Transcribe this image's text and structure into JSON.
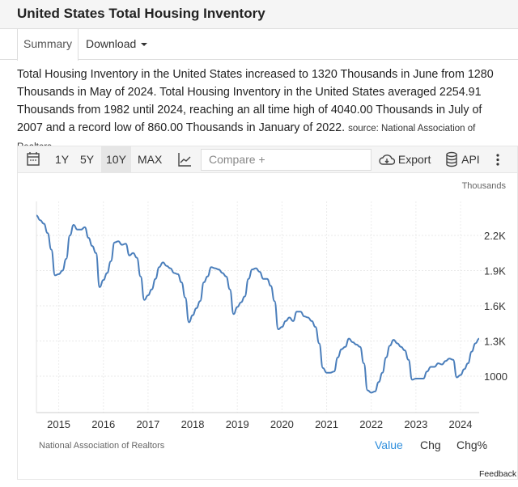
{
  "header": {
    "title": "United States Total Housing Inventory"
  },
  "tabs": {
    "summary": "Summary",
    "download": "Download"
  },
  "description": {
    "text": "Total Housing Inventory in the United States increased to 1320 Thousands in June from 1280 Thousands in May of 2024. Total Housing Inventory in the United States averaged 2254.91 Thousands from 1982 until 2024, reaching an all time high of 4040.00 Thousands in July of 2007 and a record low of 860.00 Thousands in January of 2022.",
    "source": "source: National Association of Realtors"
  },
  "toolbar": {
    "ranges": [
      "1Y",
      "5Y",
      "10Y",
      "MAX"
    ],
    "selected_range": "10Y",
    "compare_placeholder": "Compare +",
    "export": "Export",
    "api": "API"
  },
  "chart_footer": {
    "source": "National Association of Realtors",
    "views": [
      "Value",
      "Chg",
      "Chg%"
    ],
    "selected_view": "Value",
    "feedback": "Feedback"
  },
  "colors": {
    "line": "#4a7ebb",
    "active_view": "#2f8fdd"
  },
  "chart_data": {
    "type": "line",
    "unit_label": "Thousands",
    "x_tick_labels": [
      "2015",
      "2016",
      "2017",
      "2018",
      "2019",
      "2020",
      "2021",
      "2022",
      "2023",
      "2024"
    ],
    "y_ticks": [
      1000,
      1300,
      1600,
      1900,
      2200
    ],
    "y_tick_labels": [
      "1000",
      "1.3K",
      "1.6K",
      "1.9K",
      "2.2K"
    ],
    "ylim": [
      690,
      2490
    ],
    "xlim": [
      "2014-07",
      "2024-06"
    ],
    "grid": true,
    "start": "2014-07",
    "frequency": "monthly",
    "values": [
      2370,
      2330,
      2300,
      2220,
      2080,
      1860,
      1870,
      1900,
      2000,
      2200,
      2290,
      2250,
      2250,
      2270,
      2180,
      2110,
      2050,
      1760,
      1820,
      1880,
      1980,
      2140,
      2150,
      2120,
      2130,
      2030,
      2050,
      2010,
      1850,
      1650,
      1690,
      1740,
      1830,
      1930,
      1970,
      1940,
      1920,
      1880,
      1870,
      1800,
      1670,
      1460,
      1520,
      1580,
      1640,
      1800,
      1850,
      1930,
      1920,
      1910,
      1880,
      1850,
      1740,
      1530,
      1590,
      1630,
      1680,
      1830,
      1910,
      1920,
      1890,
      1830,
      1830,
      1770,
      1640,
      1400,
      1420,
      1470,
      1500,
      1470,
      1550,
      1550,
      1510,
      1500,
      1470,
      1420,
      1280,
      1070,
      1030,
      1030,
      1040,
      1160,
      1230,
      1250,
      1320,
      1290,
      1270,
      1250,
      1110,
      880,
      860,
      870,
      950,
      1030,
      1160,
      1260,
      1310,
      1280,
      1250,
      1220,
      1140,
      970,
      980,
      980,
      980,
      1040,
      1080,
      1080,
      1110,
      1100,
      1130,
      1150,
      1140,
      990,
      1010,
      1060,
      1110,
      1210,
      1280,
      1320
    ]
  }
}
